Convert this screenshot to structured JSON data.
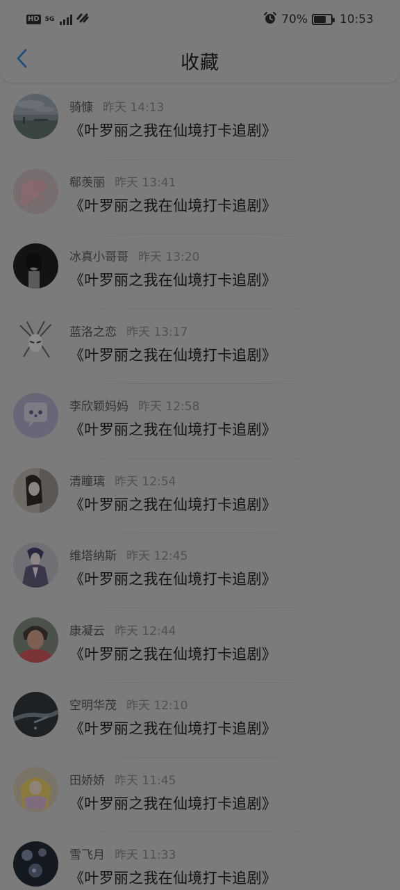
{
  "status_bar": {
    "hd": "HD",
    "network": "5G",
    "battery": "70%",
    "battery_level": 0.7,
    "time": "10:53"
  },
  "header": {
    "title": "收藏"
  },
  "items": [
    {
      "name": "骑慷",
      "time": "昨天 14:13",
      "content": "《叶罗丽之我在仙境打卡追剧》"
    },
    {
      "name": "郗羡丽",
      "time": "昨天 13:41",
      "content": "《叶罗丽之我在仙境打卡追剧》"
    },
    {
      "name": "冰真小哥哥",
      "time": "昨天 13:20",
      "content": "《叶罗丽之我在仙境打卡追剧》"
    },
    {
      "name": "蓝洛之恋",
      "time": "昨天 13:17",
      "content": "《叶罗丽之我在仙境打卡追剧》"
    },
    {
      "name": "李欣颖妈妈",
      "time": "昨天 12:58",
      "content": "《叶罗丽之我在仙境打卡追剧》"
    },
    {
      "name": "清瞳璃",
      "time": "昨天 12:54",
      "content": "《叶罗丽之我在仙境打卡追剧》"
    },
    {
      "name": "维塔纳斯",
      "time": "昨天 12:45",
      "content": "《叶罗丽之我在仙境打卡追剧》"
    },
    {
      "name": "康凝云",
      "time": "昨天 12:44",
      "content": "《叶罗丽之我在仙境打卡追剧》"
    },
    {
      "name": "空明华茂",
      "time": "昨天 12:10",
      "content": "《叶罗丽之我在仙境打卡追剧》"
    },
    {
      "name": "田娇娇",
      "time": "昨天 11:45",
      "content": "《叶罗丽之我在仙境打卡追剧》"
    },
    {
      "name": "雪飞月",
      "time": "昨天 11:33",
      "content": "《叶罗丽之我在仙境打卡追剧》"
    }
  ]
}
